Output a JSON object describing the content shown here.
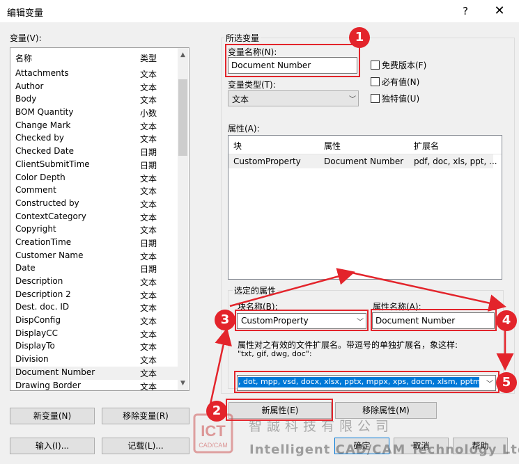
{
  "window": {
    "title": "编辑变量",
    "help_glyph": "?",
    "close_glyph": "✕"
  },
  "variables": {
    "label": "变量(V):",
    "col_name": "名称",
    "col_type": "类型",
    "rows": [
      {
        "name": "Attachments",
        "type": "文本"
      },
      {
        "name": "Author",
        "type": "文本"
      },
      {
        "name": "Body",
        "type": "文本"
      },
      {
        "name": "BOM Quantity",
        "type": "小数"
      },
      {
        "name": "Change Mark",
        "type": "文本"
      },
      {
        "name": "Checked by",
        "type": "文本"
      },
      {
        "name": "Checked Date",
        "type": "日期"
      },
      {
        "name": "ClientSubmitTime",
        "type": "日期"
      },
      {
        "name": "Color Depth",
        "type": "文本"
      },
      {
        "name": "Comment",
        "type": "文本"
      },
      {
        "name": "Constructed by",
        "type": "文本"
      },
      {
        "name": "ContextCategory",
        "type": "文本"
      },
      {
        "name": "Copyright",
        "type": "文本"
      },
      {
        "name": "CreationTime",
        "type": "日期"
      },
      {
        "name": "Customer Name",
        "type": "文本"
      },
      {
        "name": "Date",
        "type": "日期"
      },
      {
        "name": "Description",
        "type": "文本"
      },
      {
        "name": "Description 2",
        "type": "文本"
      },
      {
        "name": "Dest. doc. ID",
        "type": "文本"
      },
      {
        "name": "DispConfig",
        "type": "文本"
      },
      {
        "name": "DisplayCC",
        "type": "文本"
      },
      {
        "name": "DisplayTo",
        "type": "文本"
      },
      {
        "name": "Division",
        "type": "文本"
      },
      {
        "name": "Document Number",
        "type": "文本"
      },
      {
        "name": "Drawing Border",
        "type": "文本"
      }
    ],
    "selected_index": 23
  },
  "buttons": {
    "new_variable": "新变量(N)",
    "remove_variable": "移除变量(R)",
    "import": "输入(I)...",
    "log": "记载(L)...",
    "new_property": "新属性(E)",
    "remove_property": "移除属性(M)",
    "ok": "确定",
    "cancel": "取消",
    "help": "帮助"
  },
  "selected_variable": {
    "group_title": "所选变量",
    "name_label": "变量名称(N):",
    "name_value": "Document Number",
    "type_label": "变量类型(T):",
    "type_value": "文本",
    "checkboxes": [
      {
        "label": "免费版本(F)",
        "checked": false
      },
      {
        "label": "必有值(N)",
        "checked": false
      },
      {
        "label": "独特值(U)",
        "checked": false
      }
    ]
  },
  "properties": {
    "label": "属性(A):",
    "col_block": "块",
    "col_property": "属性",
    "col_ext": "扩展名",
    "rows": [
      {
        "block": "CustomProperty",
        "property": "Document Number",
        "ext": "pdf, doc, xls, ppt, ..."
      }
    ]
  },
  "selected_property": {
    "group_title": "选定的属性",
    "block_label": "块名称(B):",
    "block_value": "CustomProperty",
    "prop_label": "属性名称(A):",
    "prop_value": "Document Number",
    "ext_hint_1": "属性对之有效的文件扩展名。带逗号的单独扩展名，象这样:",
    "ext_hint_2": "\"txt, gif, dwg, doc\":",
    "ext_value": ", dot, mpp, vsd, docx, xlsx, pptx, mppx, xps, docm, xlsm, pptm"
  },
  "badges": [
    "1",
    "2",
    "3",
    "4",
    "5"
  ],
  "watermark": {
    "logo_text": "ICT",
    "logo_sub": "CAD/CAM",
    "chinese": "智誠科技有限公司",
    "english": "Intelligent CAD/CAM Technology Ltd."
  },
  "colors": {
    "annotation_red": "#e3242b",
    "selection_blue": "#0078d7"
  }
}
